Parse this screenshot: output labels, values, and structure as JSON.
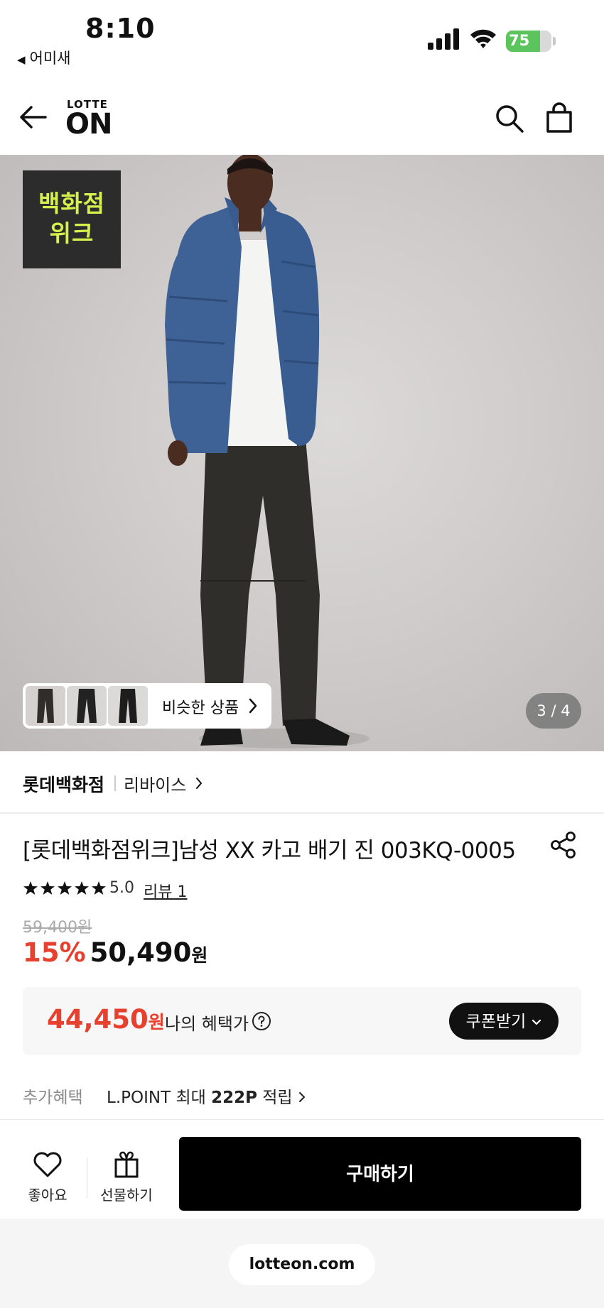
{
  "status_bar": {
    "time": "8:10",
    "back_app": "어미새",
    "battery": "75",
    "battery_level": 0.75
  },
  "header": {
    "logo_top": "LOTTE",
    "logo_bottom": "ON"
  },
  "hero": {
    "badge_line1": "백화점",
    "badge_line2": "위크",
    "similar_label": "비슷한 상품",
    "counter": "3 / 4"
  },
  "brand": {
    "store": "롯데백화점",
    "name": "리바이스"
  },
  "product": {
    "title": "[롯데백화점위크]남성 XX 카고 배기 진 003KQ-0005",
    "rating": "5.0",
    "review": "리뷰 1",
    "original_price": "59,400원",
    "discount": "15%",
    "sale_price": "50,490",
    "sale_unit": "원"
  },
  "benefit": {
    "price": "44,450",
    "unit": "원",
    "label": "나의 혜택가",
    "coupon_button": "쿠폰받기"
  },
  "extra": {
    "label": "추가혜택",
    "text_prefix": "L.POINT 최대 ",
    "points": "222P",
    "text_suffix": " 적립"
  },
  "actions": {
    "like": "좋아요",
    "gift": "선물하기",
    "buy": "구매하기"
  },
  "url": "lotteon.com",
  "colors": {
    "accent_red": "#e8402f",
    "badge_bg": "#2c2c2c",
    "badge_text": "#d6f04e",
    "battery_green": "#5cc45c"
  }
}
